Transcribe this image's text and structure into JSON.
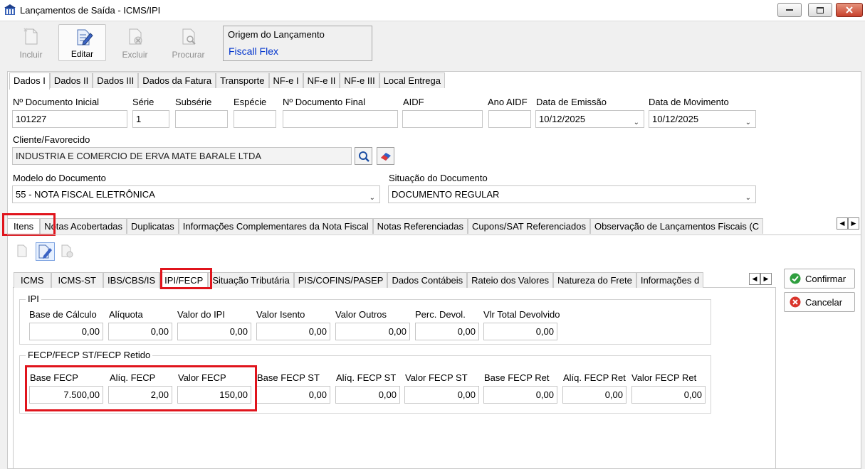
{
  "window": {
    "title": "Lançamentos de Saída - ICMS/IPI"
  },
  "toolbar": {
    "incluir": "Incluir",
    "editar": "Editar",
    "excluir": "Excluir",
    "procurar": "Procurar"
  },
  "origem": {
    "label": "Origem do Lançamento",
    "value": "Fiscall Flex"
  },
  "top_tabs": [
    "Dados I",
    "Dados II",
    "Dados III",
    "Dados da Fatura",
    "Transporte",
    "NF-e I",
    "NF-e II",
    "NF-e III",
    "Local Entrega"
  ],
  "form": {
    "num_doc_inicial": {
      "label": "Nº Documento Inicial",
      "value": "101227"
    },
    "serie": {
      "label": "Série",
      "value": "1"
    },
    "subserie": {
      "label": "Subsérie",
      "value": ""
    },
    "especie": {
      "label": "Espécie",
      "value": ""
    },
    "num_doc_final": {
      "label": "Nº Documento Final",
      "value": ""
    },
    "aidf": {
      "label": "AIDF",
      "value": ""
    },
    "ano_aidf": {
      "label": "Ano AIDF",
      "value": ""
    },
    "data_emissao": {
      "label": "Data de Emissão",
      "value": "10/12/2025"
    },
    "data_movimento": {
      "label": "Data de Movimento",
      "value": "10/12/2025"
    },
    "cliente": {
      "label": "Cliente/Favorecido",
      "value": "INDUSTRIA E COMERCIO DE ERVA MATE BARALE LTDA"
    },
    "modelo": {
      "label": "Modelo do Documento",
      "value": "55 - NOTA FISCAL ELETRÔNICA"
    },
    "situacao": {
      "label": "Situação do Documento",
      "value": "DOCUMENTO REGULAR"
    }
  },
  "mid_tabs": [
    "Itens",
    "Notas Acobertadas",
    "Duplicatas",
    "Informações Complementares da Nota Fiscal",
    "Notas Referenciadas",
    "Cupons/SAT Referenciados",
    "Observação de Lançamentos Fiscais (C"
  ],
  "inner_tabs": [
    "ICMS",
    "ICMS-ST",
    "IBS/CBS/IS",
    "IPI/FECP",
    "Situação Tributária",
    "PIS/COFINS/PASEP",
    "Dados Contábeis",
    "Rateio dos Valores",
    "Natureza do Frete",
    "Informações d"
  ],
  "ipi": {
    "title": "IPI",
    "fields": [
      {
        "label": "Base de Cálculo",
        "value": "0,00"
      },
      {
        "label": "Alíquota",
        "value": "0,00"
      },
      {
        "label": "Valor do IPI",
        "value": "0,00"
      },
      {
        "label": "Valor Isento",
        "value": "0,00"
      },
      {
        "label": "Valor Outros",
        "value": "0,00"
      },
      {
        "label": "Perc. Devol.",
        "value": "0,00"
      },
      {
        "label": "Vlr Total Devolvido",
        "value": "0,00"
      }
    ]
  },
  "fecp": {
    "title": "FECP/FECP ST/FECP Retido",
    "fields": [
      {
        "label": "Base FECP",
        "value": "7.500,00"
      },
      {
        "label": "Alíq. FECP",
        "value": "2,00"
      },
      {
        "label": "Valor FECP",
        "value": "150,00"
      },
      {
        "label": "Base FECP ST",
        "value": "0,00"
      },
      {
        "label": "Alíq. FECP ST",
        "value": "0,00"
      },
      {
        "label": "Valor FECP ST",
        "value": "0,00"
      },
      {
        "label": "Base FECP Ret",
        "value": "0,00"
      },
      {
        "label": "Alíq. FECP Ret",
        "value": "0,00"
      },
      {
        "label": "Valor FECP Ret",
        "value": "0,00"
      }
    ]
  },
  "actions": {
    "confirmar": "Confirmar",
    "cancelar": "Cancelar"
  },
  "colors": {
    "highlight": "#e0141c",
    "link_blue": "#0033cc",
    "confirm_green": "#2e9e3e",
    "cancel_red": "#d9342b"
  }
}
